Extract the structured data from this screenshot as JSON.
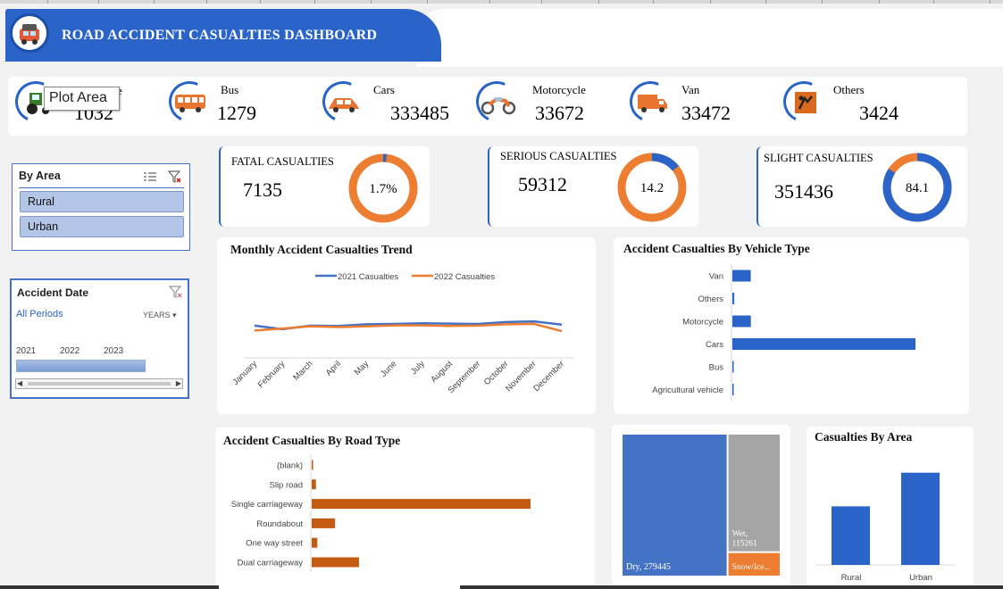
{
  "header": {
    "title": "ROAD ACCIDENT CASUALTIES DASHBOARD",
    "logo_icon": "vehicles-logo-icon"
  },
  "tooltip": "Plot Area",
  "vehicles": [
    {
      "name": "Agricultural vehicle",
      "label_visible": "e",
      "value": "1032",
      "icon": "tractor-icon"
    },
    {
      "name": "Bus",
      "value": "1279",
      "icon": "bus-icon"
    },
    {
      "name": "Cars",
      "value": "333485",
      "icon": "car-icon"
    },
    {
      "name": "Motorcycle",
      "value": "33672",
      "icon": "motorcycle-icon"
    },
    {
      "name": "Van",
      "value": "33472",
      "icon": "van-icon"
    },
    {
      "name": "Others",
      "value": "3424",
      "icon": "others-icon"
    }
  ],
  "kpis": [
    {
      "label": "FATAL CASUALTIES",
      "value": "7135",
      "pct_label": "1.7%",
      "pct": 1.7
    },
    {
      "label": "SERIOUS CASUALTIES",
      "value": "59312",
      "pct_label": "14.2",
      "pct": 14.2
    },
    {
      "label": "SLIGHT CASUALTIES",
      "value": "351436",
      "pct_label": "84.1",
      "pct": 84.1
    }
  ],
  "slicer_area": {
    "title": "By Area",
    "items": [
      "Rural",
      "Urban"
    ]
  },
  "slicer_date": {
    "title": "Accident Date",
    "periods": "All Periods",
    "unit": "YEARS",
    "years": [
      "2021",
      "2022",
      "2023"
    ]
  },
  "colors": {
    "blue": "#4472c4",
    "orange": "#ed7d31",
    "dark_orange": "#c55a11",
    "bar_blue": "#2a64c8",
    "gray": "#a5a5a5"
  },
  "chart_data": [
    {
      "type": "line",
      "title": "Monthly Accident Casualties Trend",
      "categories": [
        "January",
        "February",
        "March",
        "April",
        "May",
        "June",
        "July",
        "August",
        "September",
        "October",
        "November",
        "December"
      ],
      "series": [
        {
          "name": "2021 Casualties",
          "values": [
            19800,
            17600,
            19800,
            19600,
            20600,
            20800,
            21200,
            21000,
            20800,
            22000,
            22400,
            20400
          ]
        },
        {
          "name": "2022 Casualties",
          "values": [
            16800,
            18000,
            19400,
            18900,
            19400,
            19900,
            19900,
            19600,
            19800,
            20600,
            20900,
            16400
          ]
        }
      ],
      "ylim": [
        0,
        40000
      ]
    },
    {
      "type": "bar",
      "orientation": "horizontal",
      "title": "Accident Casualties By Vehicle Type",
      "categories": [
        "Van",
        "Others",
        "Motorcycle",
        "Cars",
        "Bus",
        "Agricultural vehicle"
      ],
      "values": [
        33472,
        3424,
        33672,
        333485,
        1279,
        1032
      ]
    },
    {
      "type": "bar",
      "orientation": "horizontal",
      "title": "Accident Casualties By Road Type",
      "categories": [
        "(blank)",
        "Slip road",
        "Single carriageway",
        "Roundabout",
        "One way street",
        "Dual carriageway"
      ],
      "values": [
        1800,
        6000,
        310000,
        33000,
        8000,
        67000
      ]
    },
    {
      "type": "treemap",
      "title": "",
      "items": [
        {
          "label": "Dry, 279445",
          "value": 279445
        },
        {
          "label": "Wet, 115261",
          "value": 115261
        },
        {
          "label": "Snow/Ice...",
          "value": 22300
        }
      ]
    },
    {
      "type": "bar",
      "title": "Casualties By Area",
      "categories": [
        "Rural",
        "Urban"
      ],
      "values": [
        160000,
        252000
      ],
      "ylim": [
        0,
        300000
      ]
    }
  ]
}
